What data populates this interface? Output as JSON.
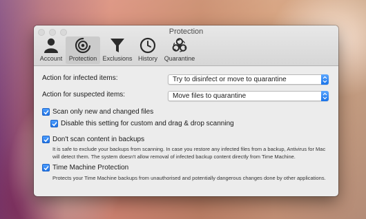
{
  "window": {
    "title": "Protection"
  },
  "tabs": [
    {
      "label": "Account",
      "icon": "account-icon"
    },
    {
      "label": "Protection",
      "icon": "protection-icon"
    },
    {
      "label": "Exclusions",
      "icon": "exclusions-funnel-icon"
    },
    {
      "label": "History",
      "icon": "history-clock-icon"
    },
    {
      "label": "Quarantine",
      "icon": "biohazard-icon"
    }
  ],
  "settings": {
    "infected_label": "Action for infected items:",
    "infected_value": "Try to disinfect or move to quarantine",
    "suspected_label": "Action for suspected items:",
    "suspected_value": "Move files to quarantine",
    "scan_new_label": "Scan only new and changed files",
    "disable_custom_label": "Disable this setting for custom and drag & drop scanning",
    "no_backups_label": "Don't scan content in backups",
    "no_backups_desc_1": "It is safe to exclude your backups from scanning. In case you restore any infected files from a backup, Antivirus for Mac",
    "no_backups_desc_2": "will detect them. The system doesn't allow removal of infected backup content directly from Time Machine.",
    "time_machine_label": "Time Machine Protection",
    "time_machine_desc": "Protects your Time Machine backups from unauthorised and potentially dangerous changes done by other applications."
  },
  "colors": {
    "accent": "#1f72e4",
    "window_bg": "#ececec"
  }
}
